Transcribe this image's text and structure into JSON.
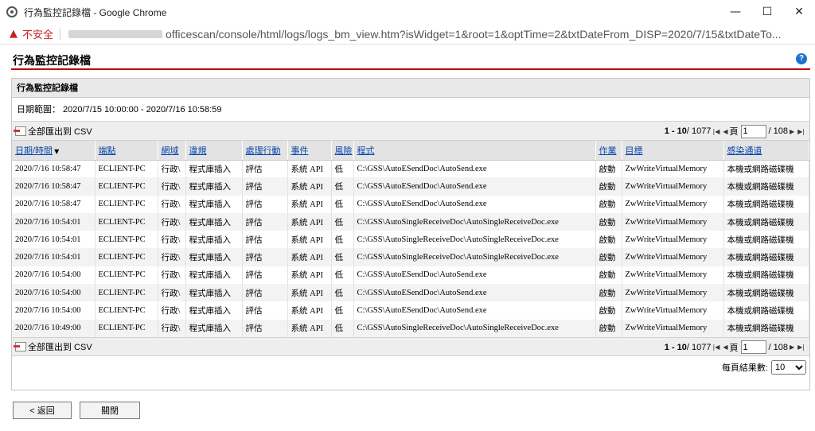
{
  "window": {
    "title": "行為監控記錄檔 - Google Chrome",
    "minimize": "—",
    "maximize": "☐",
    "close": "✕"
  },
  "address": {
    "warning": "不安全",
    "url": "officescan/console/html/logs/logs_bm_view.htm?isWidget=1&root=1&optTime=2&txtDateFrom_DISP=2020/7/15&txtDateTo..."
  },
  "page": {
    "title": "行為監控記錄檔",
    "help": "?"
  },
  "panel": {
    "header": "行為監控記錄檔",
    "date_range": "日期範圍： 2020/7/15 10:00:00 - 2020/7/16 10:58:59"
  },
  "toolbar": {
    "export_label": "全部匯出到 CSV",
    "range": "1 - 10",
    "total": "/ 1077",
    "page_label": "頁",
    "page_value": "1",
    "page_total": "/ 108"
  },
  "columns": [
    "日期/時間",
    "端點",
    "網域",
    "違規",
    "處理行動",
    "事件",
    "風險",
    "程式",
    "作業",
    "目標",
    "感染通道"
  ],
  "rows": [
    [
      "2020/7/16 10:58:47",
      "ECLIENT-PC",
      "行政\\",
      "程式庫插入",
      "評估",
      "系統 API",
      "低",
      "C:\\GSS\\AutoESendDoc\\AutoSend.exe",
      "啟動",
      "ZwWriteVirtualMemory",
      "本機或網路磁碟機"
    ],
    [
      "2020/7/16 10:58:47",
      "ECLIENT-PC",
      "行政\\",
      "程式庫插入",
      "評估",
      "系統 API",
      "低",
      "C:\\GSS\\AutoESendDoc\\AutoSend.exe",
      "啟動",
      "ZwWriteVirtualMemory",
      "本機或網路磁碟機"
    ],
    [
      "2020/7/16 10:58:47",
      "ECLIENT-PC",
      "行政\\",
      "程式庫插入",
      "評估",
      "系統 API",
      "低",
      "C:\\GSS\\AutoESendDoc\\AutoSend.exe",
      "啟動",
      "ZwWriteVirtualMemory",
      "本機或網路磁碟機"
    ],
    [
      "2020/7/16 10:54:01",
      "ECLIENT-PC",
      "行政\\",
      "程式庫插入",
      "評估",
      "系統 API",
      "低",
      "C:\\GSS\\AutoSingleReceiveDoc\\AutoSingleReceiveDoc.exe",
      "啟動",
      "ZwWriteVirtualMemory",
      "本機或網路磁碟機"
    ],
    [
      "2020/7/16 10:54:01",
      "ECLIENT-PC",
      "行政\\",
      "程式庫插入",
      "評估",
      "系統 API",
      "低",
      "C:\\GSS\\AutoSingleReceiveDoc\\AutoSingleReceiveDoc.exe",
      "啟動",
      "ZwWriteVirtualMemory",
      "本機或網路磁碟機"
    ],
    [
      "2020/7/16 10:54:01",
      "ECLIENT-PC",
      "行政\\",
      "程式庫插入",
      "評估",
      "系統 API",
      "低",
      "C:\\GSS\\AutoSingleReceiveDoc\\AutoSingleReceiveDoc.exe",
      "啟動",
      "ZwWriteVirtualMemory",
      "本機或網路磁碟機"
    ],
    [
      "2020/7/16 10:54:00",
      "ECLIENT-PC",
      "行政\\",
      "程式庫插入",
      "評估",
      "系統 API",
      "低",
      "C:\\GSS\\AutoESendDoc\\AutoSend.exe",
      "啟動",
      "ZwWriteVirtualMemory",
      "本機或網路磁碟機"
    ],
    [
      "2020/7/16 10:54:00",
      "ECLIENT-PC",
      "行政\\",
      "程式庫插入",
      "評估",
      "系統 API",
      "低",
      "C:\\GSS\\AutoESendDoc\\AutoSend.exe",
      "啟動",
      "ZwWriteVirtualMemory",
      "本機或網路磁碟機"
    ],
    [
      "2020/7/16 10:54:00",
      "ECLIENT-PC",
      "行政\\",
      "程式庫插入",
      "評估",
      "系統 API",
      "低",
      "C:\\GSS\\AutoESendDoc\\AutoSend.exe",
      "啟動",
      "ZwWriteVirtualMemory",
      "本機或網路磁碟機"
    ],
    [
      "2020/7/16 10:49:00",
      "ECLIENT-PC",
      "行政\\",
      "程式庫插入",
      "評估",
      "系統 API",
      "低",
      "C:\\GSS\\AutoSingleReceiveDoc\\AutoSingleReceiveDoc.exe",
      "啟動",
      "ZwWriteVirtualMemory",
      "本機或網路磁碟機"
    ]
  ],
  "per_page": {
    "label": "每頁結果數:",
    "value": "10"
  },
  "buttons": {
    "back": "< 返回",
    "close": "關閉"
  },
  "colors": {
    "title_rule": "#c00000",
    "link": "#0645ad",
    "warning": "#c5221f"
  },
  "icons": {
    "nav_first": "first-page-icon",
    "nav_prev": "prev-page-icon",
    "nav_next": "next-page-icon",
    "nav_last": "last-page-icon"
  }
}
